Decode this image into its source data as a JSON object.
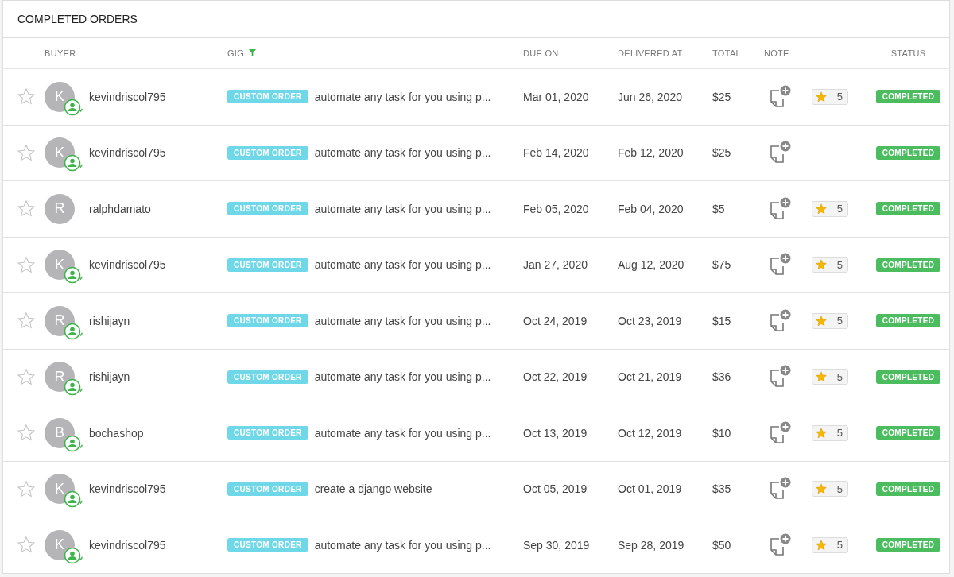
{
  "title": "COMPLETED ORDERS",
  "columns": [
    {
      "label": "BUYER",
      "kind": "text"
    },
    {
      "label": "GIG",
      "kind": "filter"
    },
    {
      "label": "DUE ON",
      "kind": "text"
    },
    {
      "label": "DELIVERED AT",
      "kind": "text"
    },
    {
      "label": "TOTAL",
      "kind": "text"
    },
    {
      "label": "NOTE",
      "kind": "note"
    },
    {
      "label": "STATUS",
      "kind": "center"
    }
  ],
  "rows": [
    {
      "starred": false,
      "initial": "K",
      "buyer": "kevindriscol795",
      "repeat": true,
      "tag": "CUSTOM ORDER",
      "gig": "automate any task for you using p...",
      "due": "Mar 01, 2020",
      "delivered": "Jun 26, 2020",
      "total": "$25",
      "rating": "5",
      "status": "COMPLETED"
    },
    {
      "starred": false,
      "initial": "K",
      "buyer": "kevindriscol795",
      "repeat": true,
      "tag": "CUSTOM ORDER",
      "gig": "automate any task for you using p...",
      "due": "Feb 14, 2020",
      "delivered": "Feb 12, 2020",
      "total": "$25",
      "status": "COMPLETED"
    },
    {
      "starred": false,
      "initial": "R",
      "buyer": "ralphdamato",
      "repeat": false,
      "tag": "CUSTOM ORDER",
      "gig": "automate any task for you using p...",
      "due": "Feb 05, 2020",
      "delivered": "Feb 04, 2020",
      "total": "$5",
      "rating": "5",
      "status": "COMPLETED"
    },
    {
      "starred": false,
      "initial": "K",
      "buyer": "kevindriscol795",
      "repeat": true,
      "tag": "CUSTOM ORDER",
      "gig": "automate any task for you using p...",
      "due": "Jan 27, 2020",
      "delivered": "Aug 12, 2020",
      "total": "$75",
      "rating": "5",
      "status": "COMPLETED"
    },
    {
      "starred": false,
      "initial": "R",
      "buyer": "rishijayn",
      "repeat": true,
      "tag": "CUSTOM ORDER",
      "gig": "automate any task for you using p...",
      "due": "Oct 24, 2019",
      "delivered": "Oct 23, 2019",
      "total": "$15",
      "rating": "5",
      "status": "COMPLETED"
    },
    {
      "starred": false,
      "initial": "R",
      "buyer": "rishijayn",
      "repeat": true,
      "tag": "CUSTOM ORDER",
      "gig": "automate any task for you using p...",
      "due": "Oct 22, 2019",
      "delivered": "Oct 21, 2019",
      "total": "$36",
      "rating": "5",
      "status": "COMPLETED"
    },
    {
      "starred": false,
      "initial": "B",
      "buyer": "bochashop",
      "repeat": true,
      "tag": "CUSTOM ORDER",
      "gig": "automate any task for you using p...",
      "due": "Oct 13, 2019",
      "delivered": "Oct 12, 2019",
      "total": "$10",
      "rating": "5",
      "status": "COMPLETED"
    },
    {
      "starred": false,
      "initial": "K",
      "buyer": "kevindriscol795",
      "repeat": true,
      "tag": "CUSTOM ORDER",
      "gig": "create a django website",
      "due": "Oct 05, 2019",
      "delivered": "Oct 01, 2019",
      "total": "$35",
      "rating": "5",
      "status": "COMPLETED"
    },
    {
      "starred": false,
      "initial": "K",
      "buyer": "kevindriscol795",
      "repeat": true,
      "tag": "CUSTOM ORDER",
      "gig": "automate any task for you using p...",
      "due": "Sep 30, 2019",
      "delivered": "Sep 28, 2019",
      "total": "$50",
      "rating": "5",
      "status": "COMPLETED"
    }
  ]
}
